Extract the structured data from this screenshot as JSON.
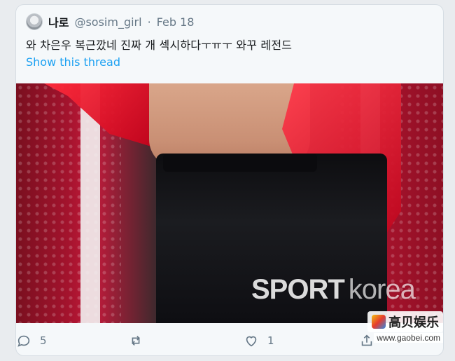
{
  "tweet": {
    "author_name": "나로",
    "author_handle": "@sosim_girl",
    "separator": "·",
    "date": "Feb 18",
    "text": "와 차은우 복근깠네 진짜 개 섹시하다ㅜㅠㅜ 와꾸 레전드",
    "show_thread": "Show this thread",
    "media": {
      "watermark_bold": "SPORT",
      "watermark_light": "korea"
    },
    "actions": {
      "reply_count": "5",
      "retweet_count": "",
      "like_count": "1"
    }
  },
  "overlay_badge": {
    "text": "高贝娱乐",
    "url": "www.gaobei.com"
  },
  "icons": [
    "avatar",
    "reply-icon",
    "retweet-icon",
    "like-icon",
    "share-icon"
  ],
  "colors": {
    "link": "#1da1f2",
    "muted": "#657786",
    "background": "#f5f8fa"
  }
}
